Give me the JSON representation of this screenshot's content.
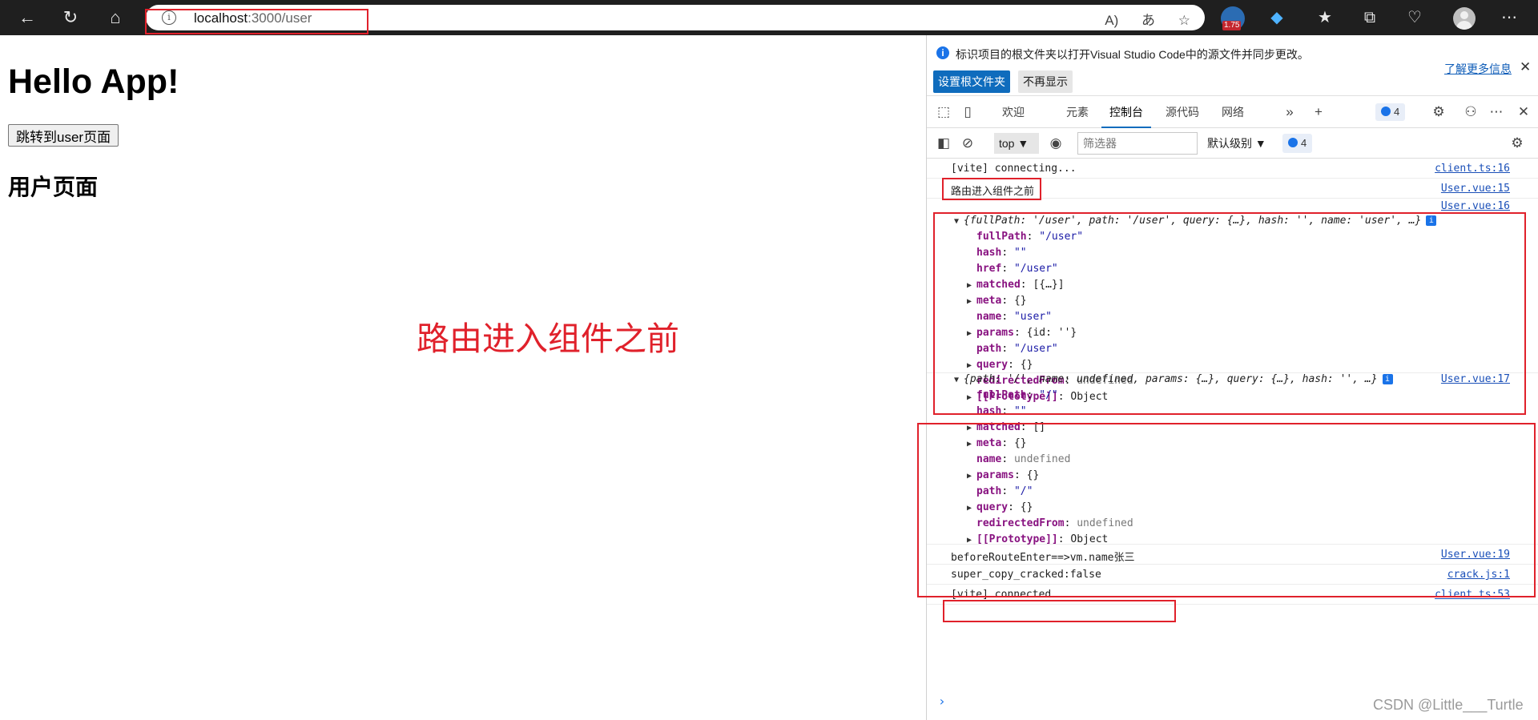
{
  "browser": {
    "url_host": "localhost",
    "url_path": ":3000/user",
    "badge_value": "1.75"
  },
  "page": {
    "heading": "Hello App!",
    "jump_button": "跳转到user页面",
    "subheading": "用户页面",
    "annotation": "路由进入组件之前"
  },
  "devtools": {
    "infobar": {
      "message": "标识项目的根文件夹以打开Visual Studio Code中的源文件并同步更改。",
      "set_root_button": "设置根文件夹",
      "dont_show_button": "不再显示",
      "learn_more": "了解更多信息"
    },
    "tabs": [
      {
        "label": "欢迎"
      },
      {
        "label": "元素"
      },
      {
        "label": "控制台"
      },
      {
        "label": "源代码"
      },
      {
        "label": "网络"
      }
    ],
    "message_count": "4",
    "filter": {
      "context": "top",
      "placeholder": "筛选器",
      "level": "默认级别",
      "count": "4"
    },
    "console": {
      "lines": [
        {
          "text": "[vite] connecting...",
          "source": "client.ts:16"
        },
        {
          "text": "路由进入组件之前",
          "source": "User.vue:15"
        },
        {
          "source": "User.vue:16"
        }
      ],
      "obj1": {
        "summary": "{fullPath: '/user', path: '/user', query: {…}, hash: '', name: 'user', …}",
        "props": [
          {
            "key": "fullPath",
            "value": "\"/user\"",
            "kind": "s",
            "expandable": false
          },
          {
            "key": "hash",
            "value": "\"\"",
            "kind": "s",
            "expandable": false
          },
          {
            "key": "href",
            "value": "\"/user\"",
            "kind": "s",
            "expandable": false
          },
          {
            "key": "matched",
            "value": "[{…}]",
            "kind": "n",
            "expandable": true
          },
          {
            "key": "meta",
            "value": "{}",
            "kind": "n",
            "expandable": true
          },
          {
            "key": "name",
            "value": "\"user\"",
            "kind": "s",
            "expandable": false
          },
          {
            "key": "params",
            "value": "{id: ''}",
            "kind": "n",
            "expandable": true
          },
          {
            "key": "path",
            "value": "\"/user\"",
            "kind": "s",
            "expandable": false
          },
          {
            "key": "query",
            "value": "{}",
            "kind": "n",
            "expandable": true
          },
          {
            "key": "redirectedFrom",
            "value": "undefined",
            "kind": "u",
            "expandable": false
          },
          {
            "key": "[[Prototype]]",
            "value": "Object",
            "kind": "n",
            "expandable": true
          }
        ]
      },
      "obj2": {
        "summary": "{path: '/', name: undefined, params: {…}, query: {…}, hash: '', …}",
        "source": "User.vue:17",
        "props": [
          {
            "key": "fullPath",
            "value": "\"/\"",
            "kind": "s",
            "expandable": false
          },
          {
            "key": "hash",
            "value": "\"\"",
            "kind": "s",
            "expandable": false
          },
          {
            "key": "matched",
            "value": "[]",
            "kind": "n",
            "expandable": true
          },
          {
            "key": "meta",
            "value": "{}",
            "kind": "n",
            "expandable": true
          },
          {
            "key": "name",
            "value": "undefined",
            "kind": "u",
            "expandable": false
          },
          {
            "key": "params",
            "value": "{}",
            "kind": "n",
            "expandable": true
          },
          {
            "key": "path",
            "value": "\"/\"",
            "kind": "s",
            "expandable": false
          },
          {
            "key": "query",
            "value": "{}",
            "kind": "n",
            "expandable": true
          },
          {
            "key": "redirectedFrom",
            "value": "undefined",
            "kind": "u",
            "expandable": false
          },
          {
            "key": "[[Prototype]]",
            "value": "Object",
            "kind": "n",
            "expandable": true
          }
        ]
      },
      "tail": [
        {
          "text": "beforeRouteEnter==>vm.name张三",
          "source": "User.vue:19"
        },
        {
          "text": "super_copy_cracked:false",
          "source": "crack.js:1"
        },
        {
          "text": "[vite] connected.",
          "source": "client.ts:53"
        }
      ]
    }
  },
  "watermark": "CSDN @Little___Turtle",
  "colors": {
    "annotation_red": "#e0212b",
    "link_blue": "#1a4fb8",
    "accent": "#0f6cbd"
  }
}
